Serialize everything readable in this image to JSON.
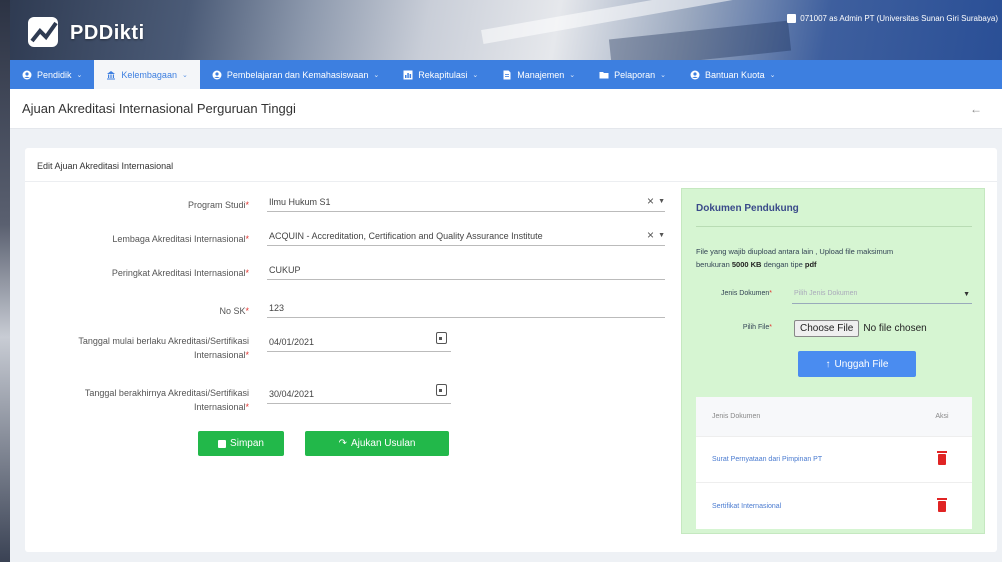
{
  "brand": {
    "name": "PDDikti"
  },
  "user": {
    "text": "071007 as Admin PT (Universitas Sunan Giri Surabaya)"
  },
  "nav": [
    {
      "label": "Pendidik",
      "icon": "user-circle-icon",
      "active": false
    },
    {
      "label": "Kelembagaan",
      "icon": "institution-icon",
      "active": true
    },
    {
      "label": "Pembelajaran dan Kemahasiswaan",
      "icon": "user-circle-icon",
      "active": false
    },
    {
      "label": "Rekapitulasi",
      "icon": "chart-icon",
      "active": false
    },
    {
      "label": "Manajemen",
      "icon": "document-icon",
      "active": false
    },
    {
      "label": "Pelaporan",
      "icon": "folder-icon",
      "active": false
    },
    {
      "label": "Bantuan Kuota",
      "icon": "user-circle-icon",
      "active": false
    }
  ],
  "page": {
    "title": "Ajuan Akreditasi Internasional Perguruan Tinggi"
  },
  "form": {
    "title": "Edit Ajuan Akreditasi Internasional",
    "program_studi": {
      "label": "Program Studi",
      "value": "Ilmu Hukum S1"
    },
    "lembaga": {
      "label": "Lembaga Akreditasi Internasional",
      "value": "ACQUIN - Accreditation, Certification and Quality Assurance Institute"
    },
    "peringkat": {
      "label": "Peringkat Akreditasi Internasional",
      "value": "CUKUP"
    },
    "no_sk": {
      "label": "No SK",
      "value": "123"
    },
    "tgl_mulai": {
      "label_1": "Tanggal mulai berlaku Akreditasi/Sertifikasi",
      "label_2": "Internasional",
      "value": "04/01/2021"
    },
    "tgl_akhir": {
      "label_1": "Tanggal berakhirnya Akreditasi/Sertifikasi",
      "label_2": "Internasional",
      "value": "30/04/2021"
    },
    "save_label": "Simpan",
    "submit_label": "Ajukan Usulan"
  },
  "panel": {
    "title": "Dokumen Pendukung",
    "note_1": "File yang wajib diupload antara lain , Upload file maksimum",
    "note_2": "berukuran",
    "note_size": "5000 KB",
    "note_3": "dengan tipe",
    "note_type": "pdf",
    "jenis_label": "Jenis Dokumen",
    "jenis_placeholder": "Pilih Jenis Dokumen",
    "file_label": "Pilih File",
    "file_button": "Choose File",
    "file_status": "No file chosen",
    "upload_label": "Unggah File",
    "table_headers": [
      "Jenis Dokumen",
      "Aksi"
    ],
    "documents": [
      "Surat Pernyataan dari Pimpinan PT",
      "Sertifikat Internasional"
    ]
  },
  "colors": {
    "primary": "#3d7fe0",
    "success": "#22b84a",
    "panel_bg": "#d6f5d2",
    "danger": "#e02424"
  }
}
